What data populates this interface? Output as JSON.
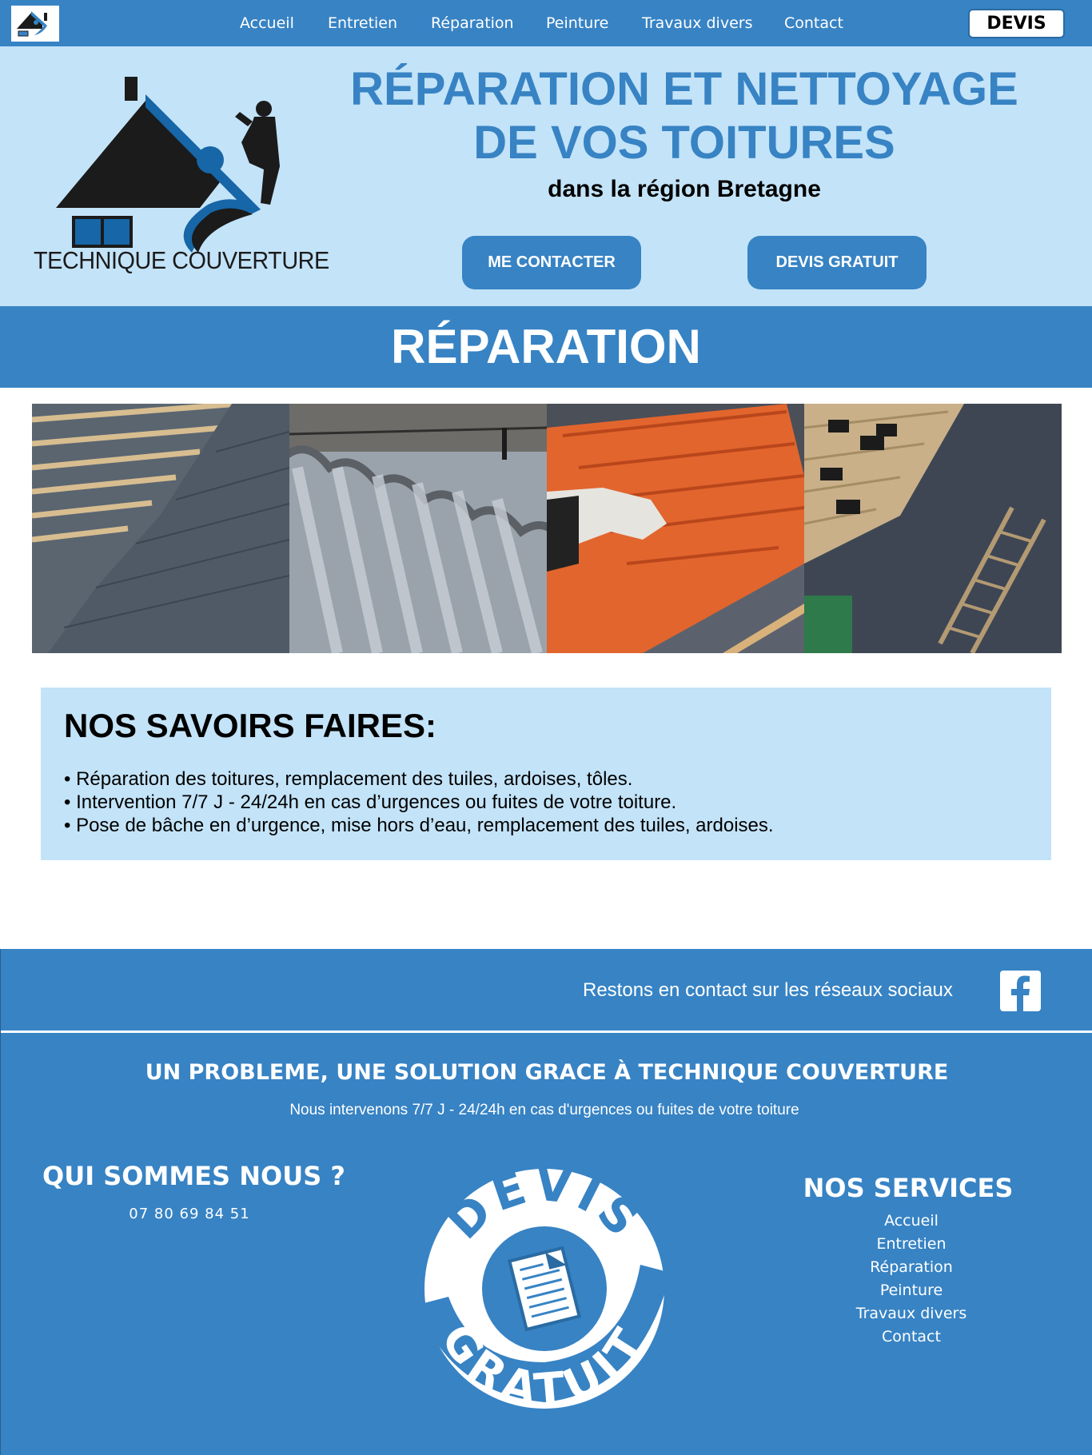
{
  "nav": {
    "items": [
      "Accueil",
      "Entretien",
      "Réparation",
      "Peinture",
      "Travaux divers",
      "Contact"
    ],
    "devis_label": "DEVIS"
  },
  "hero": {
    "logo_text": "TECHNIQUE COUVERTURE",
    "title_line1": "RÉPARATION ET NETTOYAGE",
    "title_line2": "DE VOS TOITURES",
    "subtitle": "dans la région Bretagne",
    "btn_contact": "ME CONTACTER",
    "btn_devis": "DEVIS GRATUIT"
  },
  "section": {
    "title": "RÉPARATION"
  },
  "gallery": {
    "photos": [
      "slate-roof-photo",
      "corrugated-sheet-photo",
      "terracotta-tiles-photo",
      "slate-ladder-photo"
    ]
  },
  "savoir": {
    "title": "NOS SAVOIRS FAIRES:",
    "items": [
      "• Réparation des toitures, remplacement des tuiles, ardoises, tôles.",
      "• Intervention 7/7 J - 24/24h en cas d’urgences ou fuites de votre toiture.",
      "• Pose de bâche en d’urgence, mise hors d’eau, remplacement des tuiles, ardoises."
    ]
  },
  "footer": {
    "social_text": "Restons en contact sur les réseaux sociaux",
    "title": "UN PROBLEME, UNE SOLUTION GRACE À TECHNIQUE COUVERTURE",
    "subtitle": "Nous intervenons 7/7 J - 24/24h en cas d'urgences ou fuites de votre toiture",
    "qui_title": "QUI SOMMES NOUS ?",
    "phone": "07 80 69 84 51",
    "badge_top": "DEVIS",
    "badge_bottom": "GRATUIT",
    "services_title": "NOS SERVICES",
    "services": [
      "Accueil",
      "Entretien",
      "Réparation",
      "Peinture",
      "Travaux divers",
      "Contact"
    ]
  },
  "colors": {
    "primary": "#3783c4",
    "light": "#c3e3f8",
    "dark": "#1b1b1b"
  }
}
